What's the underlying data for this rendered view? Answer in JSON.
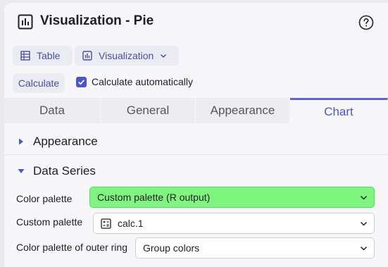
{
  "header": {
    "title": "Visualization - Pie",
    "title_icon": "bar-chart-icon",
    "help_icon": "help-circle-icon"
  },
  "view_toggle": {
    "table_label": "Table",
    "visualization_label": "Visualization",
    "table_icon": "table-grid-icon",
    "visualization_icon": "bar-chart-icon"
  },
  "calculate": {
    "button_label": "Calculate",
    "auto_label": "Calculate automatically",
    "auto_checked": true
  },
  "tabs": [
    {
      "label": "Data",
      "active": false
    },
    {
      "label": "General",
      "active": false
    },
    {
      "label": "Appearance",
      "active": false
    },
    {
      "label": "Chart",
      "active": true
    }
  ],
  "sections": {
    "appearance": {
      "label": "Appearance",
      "expanded": false
    },
    "data_series": {
      "label": "Data Series",
      "expanded": true
    }
  },
  "fields": {
    "color_palette": {
      "label": "Color palette",
      "value": "Custom palette (R output)"
    },
    "custom_palette": {
      "label": "Custom palette",
      "value": "calc.1",
      "icon": "calculation-icon"
    },
    "outer_ring": {
      "label": "Color palette of outer ring",
      "value": "Group colors"
    }
  },
  "colors": {
    "accent": "#4a56c8",
    "highlight": "#7ff57f",
    "button_bg": "#ebebf4"
  }
}
